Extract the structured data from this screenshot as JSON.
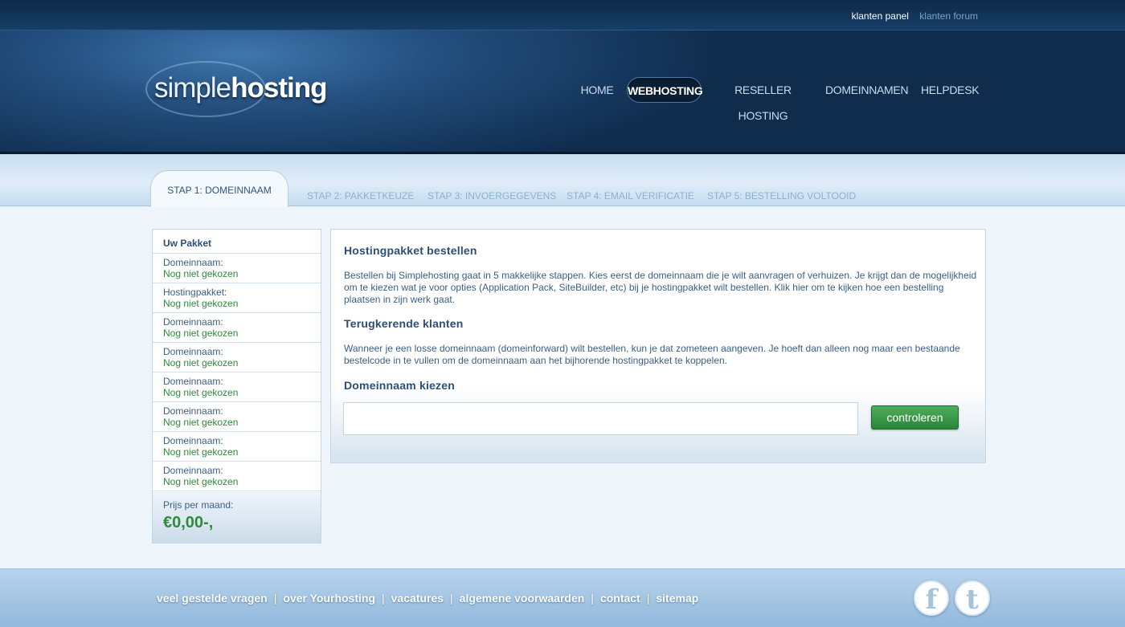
{
  "toplinks": {
    "panel": "klanten panel",
    "forum": "klanten forum"
  },
  "logo": {
    "part1": "simple",
    "part2": "hosting"
  },
  "nav": {
    "items": [
      {
        "label": "HOME"
      },
      {
        "label": "WEBHOSTING",
        "active": true
      },
      {
        "label": "RESELLER HOSTING"
      },
      {
        "label": "DOMEINNAMEN"
      },
      {
        "label": "HELPDESK"
      }
    ]
  },
  "steps": [
    {
      "label": "STAP 1: DOMEINNAAM",
      "active": true
    },
    {
      "label": "STAP 2: PAKKETKEUZE"
    },
    {
      "label": "STAP 3: INVOERGEGEVENS"
    },
    {
      "label": "STAP 4: EMAIL VERIFICATIE"
    },
    {
      "label": "STAP 5: BESTELLING VOLTOOID"
    }
  ],
  "sidebar": {
    "title": "Uw Pakket",
    "rows": [
      {
        "key": "Domeinnaam:",
        "value": "Nog niet gekozen"
      },
      {
        "key": "Hostingpakket:",
        "value": "Nog niet gekozen"
      },
      {
        "key": "Domeinnaam:",
        "value": "Nog niet gekozen"
      },
      {
        "key": "Domeinnaam:",
        "value": "Nog niet gekozen"
      },
      {
        "key": "Domeinnaam:",
        "value": "Nog niet gekozen"
      },
      {
        "key": "Domeinnaam:",
        "value": "Nog niet gekozen"
      },
      {
        "key": "Domeinnaam:",
        "value": "Nog niet gekozen"
      },
      {
        "key": "Domeinnaam:",
        "value": "Nog niet gekozen"
      }
    ],
    "price_label": "Prijs per maand:",
    "price_value": "€0,00-,"
  },
  "main": {
    "heading1": "Hostingpakket bestellen",
    "para1": "Bestellen bij Simplehosting gaat in 5 makkelijke stappen. Kies eerst de domeinnaam die je wilt aanvragen of verhuizen. Je krijgt dan de mogelijkheid om te kiezen wat je voor opties (Application Pack, SiteBuilder, etc) bij je hostingpakket wilt bestellen. Klik hier om te kijken hoe een bestelling plaatsen in zijn werk gaat.",
    "heading2": "Terugkerende klanten",
    "para2": "Wanneer je een losse domeinnaam (domeinforward) wilt bestellen, kun je dat zometeen aangeven. Je hoeft dan alleen nog maar een bestaande bestelcode in te vullen om de domeinnaam aan het bijhorende hostingpakket te koppelen.",
    "heading3": "Domeinnaam kiezen",
    "input_value": "",
    "button_label": "controleren"
  },
  "footer": {
    "links": [
      "veel gestelde vragen",
      "over Yourhosting",
      "vacatures",
      "algemene voorwaarden",
      "contact",
      "sitemap"
    ],
    "separator": "|",
    "facebook_glyph": "f",
    "twitter_glyph": "t"
  },
  "icons": {
    "facebook": "facebook-icon",
    "twitter": "twitter-icon"
  }
}
